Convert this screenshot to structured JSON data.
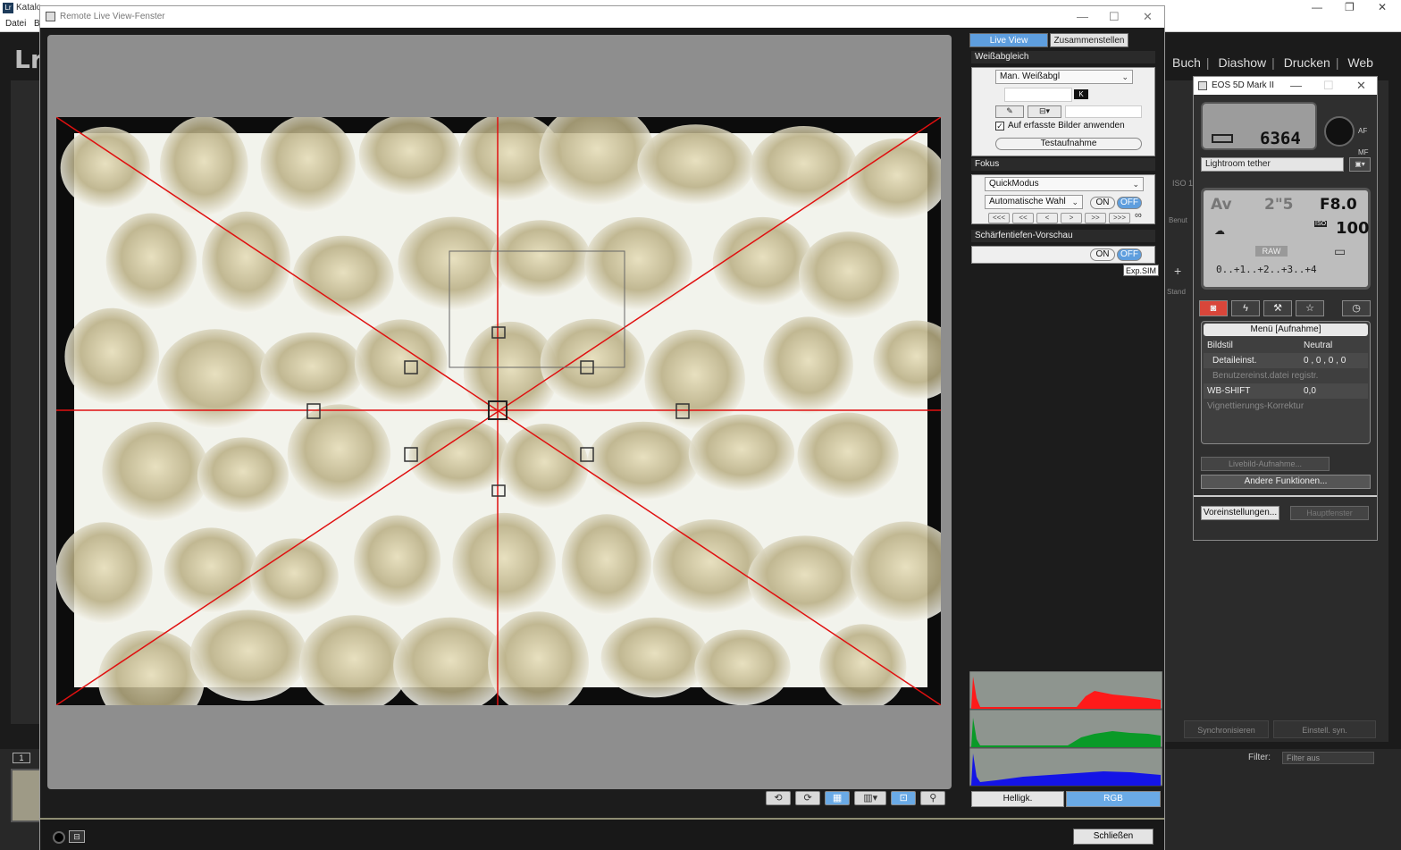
{
  "lightroom": {
    "title": "Katalo",
    "logo_small": "Lr",
    "logo_big": "Lr",
    "menu": [
      "Datei",
      "B"
    ],
    "modules": [
      "Buch",
      "Diashow",
      "Drucken",
      "Web"
    ],
    "filter_label": "Filter:",
    "filter_value": "Filter aus",
    "sync_label": "Synchronisieren",
    "sync_settings_label": "Einstell. syn.",
    "filmstrip_page": "1",
    "side_labels": [
      "ISO 1",
      "Benut",
      "Stand"
    ]
  },
  "remote": {
    "title": "Remote Live View-Fenster",
    "tabs": {
      "live_view": "Live View",
      "combine": "Zusammenstellen"
    },
    "white_balance": {
      "header": "Weißabgleich",
      "mode": "Man. Weißabgl",
      "kelvin_badge": "K",
      "apply_checkbox_label": "Auf erfasste Bilder anwenden",
      "apply_checked": true,
      "test_shot": "Testaufnahme"
    },
    "focus": {
      "header": "Fokus",
      "mode": "QuickModus",
      "af_point": "Automatische Wahl",
      "on": "ON",
      "off": "OFF",
      "nav": [
        "<<<",
        "<<",
        "<",
        ">",
        ">>",
        ">>>"
      ],
      "infinity": "∞"
    },
    "dof": {
      "header": "Schärfentiefen-Vorschau",
      "on": "ON",
      "off": "OFF",
      "exp_sim": "Exp.SIM"
    },
    "histogram": {
      "bright_label": "Helligk.",
      "rgb_label": "RGB",
      "active": "RGB"
    },
    "close_label": "Schließen",
    "toolbar_icons": [
      "rotate-left-icon",
      "rotate-right-icon",
      "grid-icon",
      "aspect-icon",
      "zoom-frame-icon",
      "magnifier-icon"
    ]
  },
  "eos": {
    "title": "EOS 5D Mark II",
    "shots_remaining": "6364",
    "label": "Lightroom tether",
    "mode": "Av",
    "shutter": "2\"5",
    "aperture": "F8.0",
    "iso": "100",
    "iso_tag": "ISO",
    "quality": "RAW",
    "exposure_scale": "0..+1..+2..+3..+4",
    "af_label": "AF",
    "mf_label": "MF",
    "menu": {
      "header": "Menü [Aufnahme]",
      "rows": [
        {
          "label": "Bildstil",
          "value": "Neutral"
        },
        {
          "label": "Detaileinst.",
          "value": "0 , 0 , 0 , 0"
        },
        {
          "label": "Benutzereinst.datei registr.",
          "value": ""
        },
        {
          "label": "WB-SHIFT",
          "value": "0,0"
        },
        {
          "label": "Vignettierungs-Korrektur",
          "value": ""
        }
      ]
    },
    "live_shot_label": "Livebild-Aufnahme...",
    "other_functions_label": "Andere Funktionen...",
    "preferences_label": "Voreinstellungen...",
    "main_window_label": "Hauptfenster"
  },
  "colors": {
    "accent": "#5e9ede",
    "overlay_red": "#e01010",
    "eos_tab_red": "#d9463a"
  }
}
